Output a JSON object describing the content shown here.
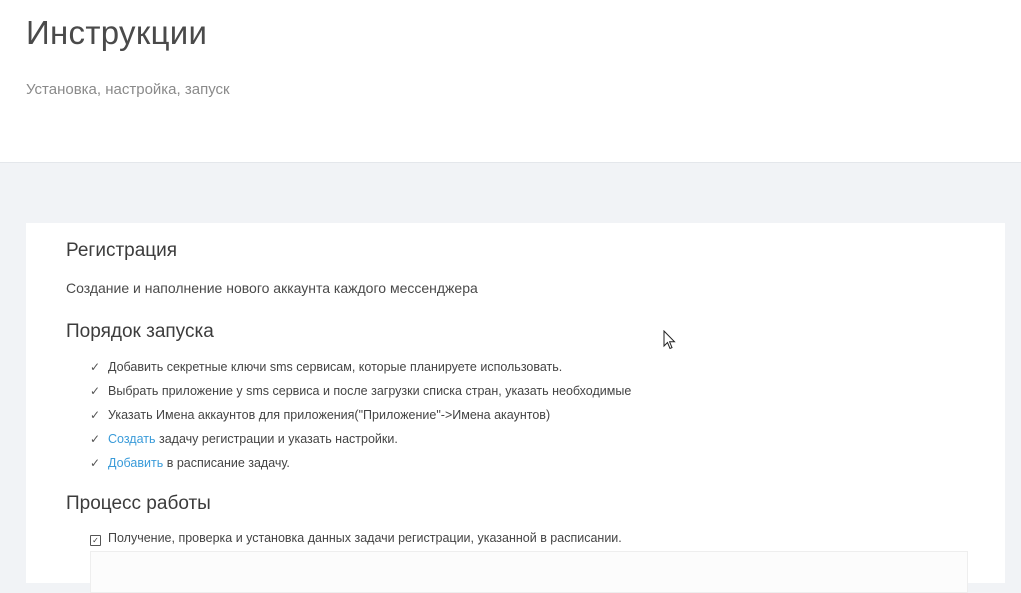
{
  "header": {
    "title": "Инструкции",
    "subtitle": "Установка, настройка, запуск"
  },
  "registration": {
    "title": "Регистрация",
    "description": "Создание и наполнение нового аккаунта каждого мессенджера"
  },
  "launch_order": {
    "title": "Порядок запуска",
    "steps": [
      {
        "text": "Добавить секретные ключи sms сервисам, которые планируете использовать."
      },
      {
        "text": "Выбрать приложение у sms сервиса и после загрузки списка стран, указать необходимые"
      },
      {
        "text": "Указать Имена аккаунтов для приложения(\"Приложение\"->Имена акаунтов)"
      },
      {
        "link": "Создать",
        "text": " задачу регистрации и указать настройки."
      },
      {
        "link": "Добавить",
        "text": " в расписание задачу."
      }
    ]
  },
  "work_process": {
    "title": "Процесс работы",
    "items": [
      {
        "text": "Получение, проверка и установка данных задачи регистрации, указанной в расписании."
      }
    ]
  },
  "icons": {
    "check": "check-icon",
    "checkbox": "checked-box-icon",
    "cursor": "mouse-pointer-icon"
  },
  "colors": {
    "link": "#3a9bd9",
    "background": "#f1f3f6",
    "panel": "#ffffff"
  }
}
